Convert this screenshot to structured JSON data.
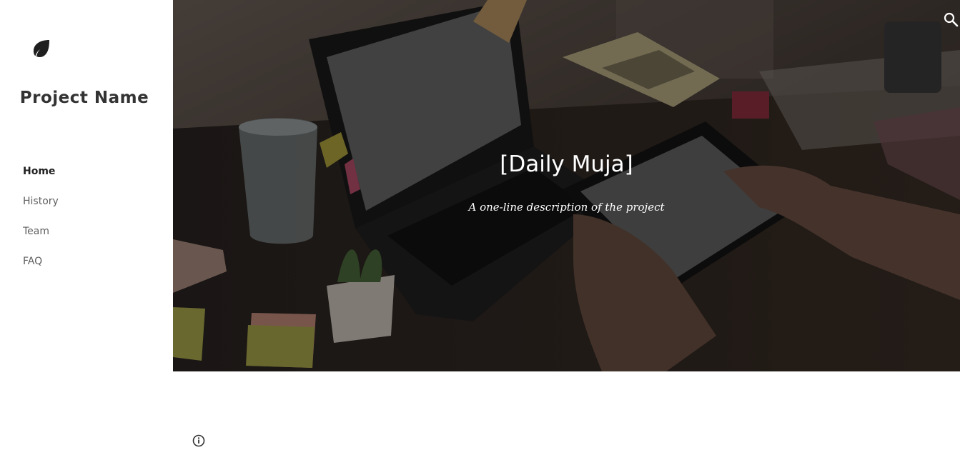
{
  "site": {
    "name": "Project Name",
    "logo_icon": "leaf-icon"
  },
  "nav": {
    "items": [
      {
        "label": "Home",
        "active": true
      },
      {
        "label": "History",
        "active": false
      },
      {
        "label": "Team",
        "active": false
      },
      {
        "label": "FAQ",
        "active": false
      }
    ]
  },
  "hero": {
    "title": "[Daily Muja]",
    "description": "A one-line description of the project",
    "search_icon": "search-icon"
  },
  "footer": {
    "info_icon": "info-icon"
  },
  "colors": {
    "sidebar_bg": "#ffffff",
    "text_dark": "#333333",
    "nav_text": "#5f5f5f",
    "hero_text": "#ffffff"
  }
}
